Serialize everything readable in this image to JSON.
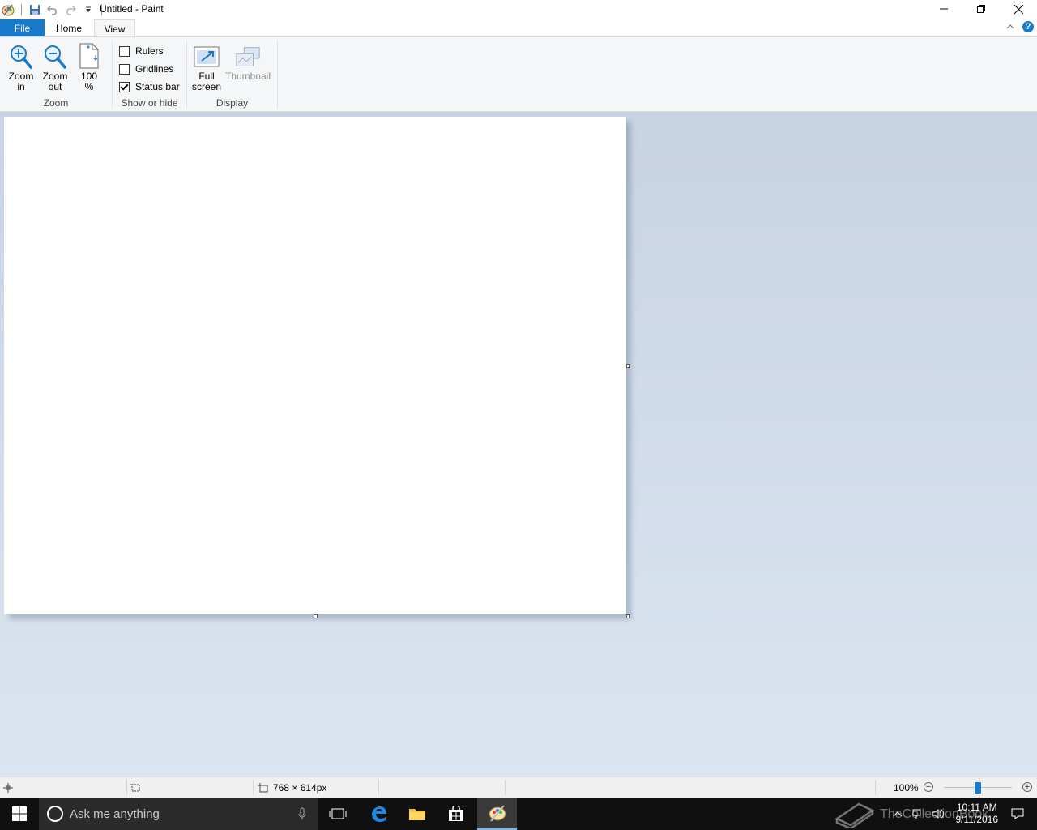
{
  "window": {
    "title": "Untitled - Paint"
  },
  "tabs": {
    "file": "File",
    "home": "Home",
    "view": "View"
  },
  "ribbon": {
    "zoom_group": {
      "label": "Zoom",
      "zoom_in": [
        "Zoom",
        "in"
      ],
      "zoom_out": [
        "Zoom",
        "out"
      ],
      "hundred": [
        "100",
        "%"
      ]
    },
    "show_hide_group": {
      "label": "Show or hide",
      "rulers": {
        "label": "Rulers",
        "checked": false
      },
      "gridlines": {
        "label": "Gridlines",
        "checked": false
      },
      "status_bar": {
        "label": "Status bar",
        "checked": true
      }
    },
    "display_group": {
      "label": "Display",
      "full_screen": [
        "Full",
        "screen"
      ],
      "thumbnail": "Thumbnail"
    }
  },
  "statusbar": {
    "canvas_size": "768 × 614px",
    "zoom_level": "100%",
    "zoom_slider_value": 0.5
  },
  "taskbar": {
    "search_placeholder": "Ask me anything",
    "time": "10:11 AM",
    "date": "9/11/2016"
  },
  "watermark": "TheCollectionBook",
  "colors": {
    "accent": "#1979ca",
    "ribbon_bg": "#f5f6f7",
    "workspace_top": "#c8d3e3",
    "workspace_bottom": "#dbe5f1",
    "taskbar": "#101010"
  }
}
